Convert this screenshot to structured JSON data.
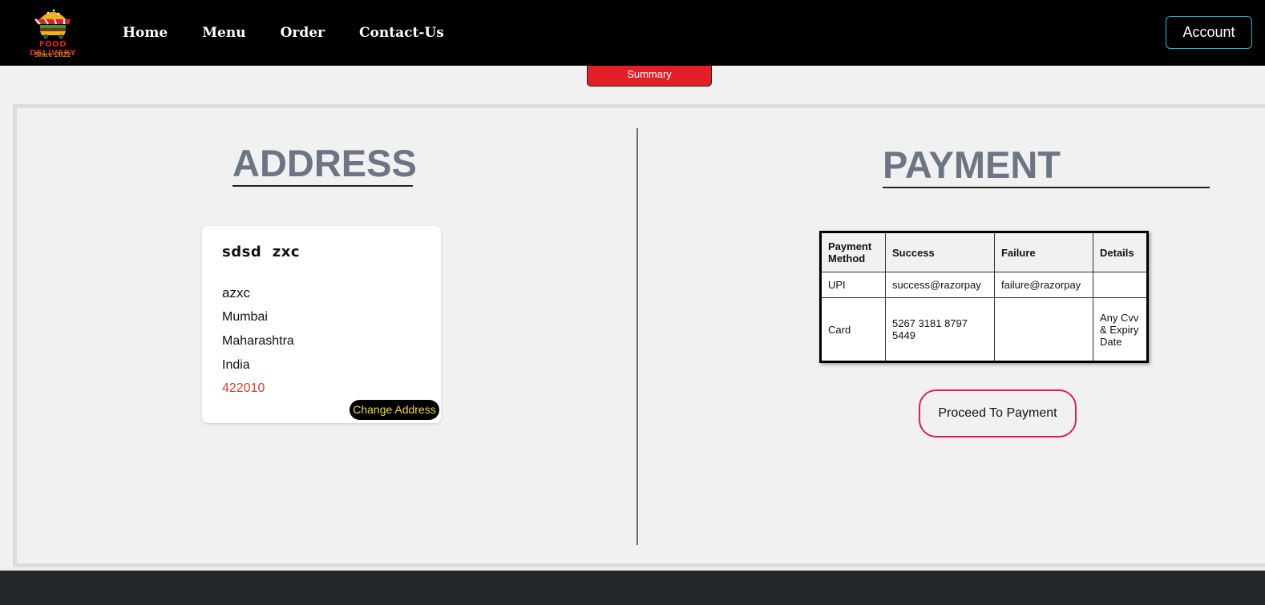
{
  "brand": {
    "name": "FOOD DELIVERY",
    "tagline": "Since 2022"
  },
  "nav": {
    "items": [
      {
        "label": "Home"
      },
      {
        "label": "Menu"
      },
      {
        "label": "Order"
      },
      {
        "label": "Contact-Us"
      }
    ]
  },
  "account": {
    "label": "Account"
  },
  "summary_tab": {
    "label": "Summary"
  },
  "address": {
    "title": "ADDRESS",
    "name": "sdsd  zxc",
    "line1": "azxc",
    "city": "Mumbai",
    "state": "Maharashtra",
    "country": "India",
    "zip": "422010",
    "change_label": "Change Address"
  },
  "payment": {
    "title": "PAYMENT",
    "columns": [
      "Payment Method",
      "Success",
      "Failure",
      "Details"
    ],
    "rows": [
      [
        "UPI",
        "success@razorpay",
        "failure@razorpay",
        ""
      ],
      [
        "Card",
        "5267 3181 8797 5449",
        "",
        "Any Cvv & Expiry Date"
      ]
    ],
    "proceed_label": "Proceed To Payment"
  },
  "colors": {
    "accent_red": "#e21f26",
    "nav_bg": "#000000",
    "account_border": "#2bb8c4",
    "proceed_border": "#e01e52"
  }
}
